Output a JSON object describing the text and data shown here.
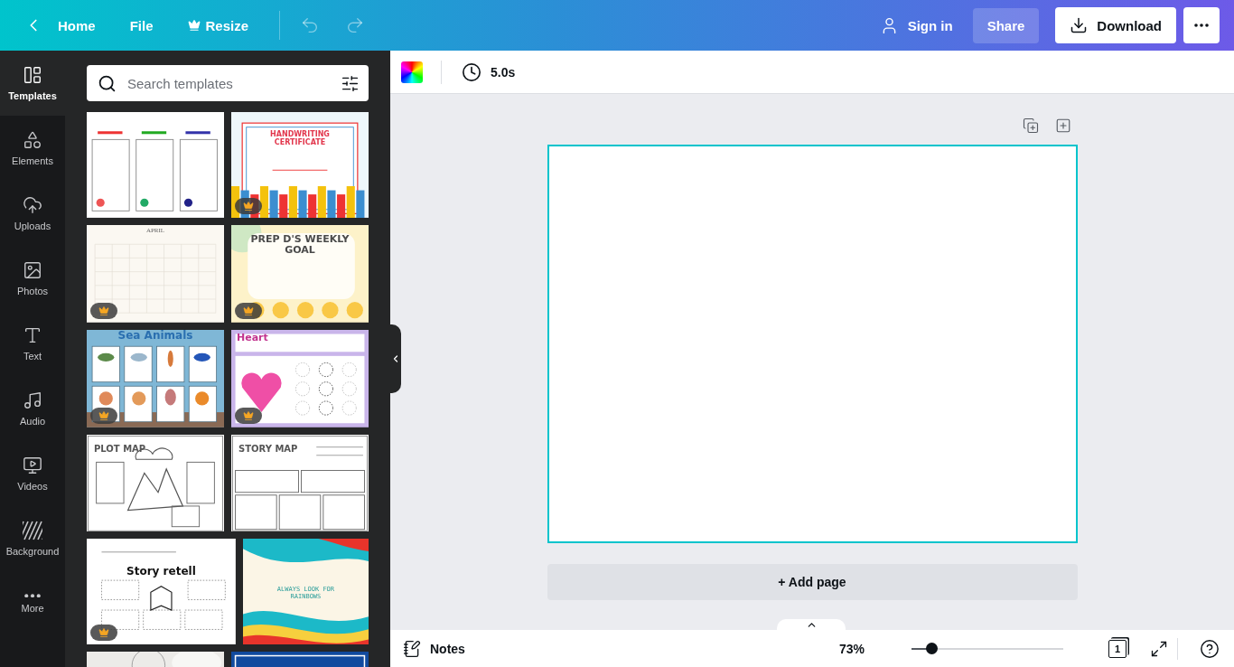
{
  "top_bar": {
    "back": "Home",
    "menu": [
      {
        "label": "File",
        "kind": "plain"
      },
      {
        "label": "Resize",
        "kind": "premium"
      }
    ],
    "sign_in": "Sign in",
    "share": "Share",
    "download": "Download"
  },
  "sidebar": {
    "items": [
      {
        "label": "Templates",
        "selected": true
      },
      {
        "label": "Elements",
        "selected": false
      },
      {
        "label": "Uploads",
        "selected": false
      },
      {
        "label": "Photos",
        "selected": false
      },
      {
        "label": "Text",
        "selected": false
      },
      {
        "label": "Audio",
        "selected": false
      },
      {
        "label": "Videos",
        "selected": false
      },
      {
        "label": "Background",
        "selected": false
      },
      {
        "label": "More",
        "selected": false
      }
    ]
  },
  "templates_panel": {
    "search": {
      "placeholder": "Search templates"
    },
    "rows": [
      [
        {
          "kind": "reading",
          "premium": false
        },
        {
          "kind": "certificate",
          "title": "HANDWRITING CERTIFICATE",
          "premium": true
        }
      ],
      [
        {
          "kind": "calendar",
          "title": "APRIL",
          "premium": true
        },
        {
          "kind": "goal",
          "title": "PREP D'S WEEKLY GOAL",
          "premium": true
        }
      ],
      [
        {
          "kind": "animals",
          "title": "Sea Animals",
          "premium": true
        },
        {
          "kind": "heart",
          "title": "Heart",
          "premium": true
        }
      ],
      [
        {
          "kind": "plotmap",
          "title": "PLOT MAP",
          "premium": false
        },
        {
          "kind": "storymap",
          "title": "STORY MAP",
          "premium": false
        }
      ],
      [
        {
          "kind": "retell",
          "title": "Story retell",
          "premium": true
        },
        {
          "kind": "rainbow",
          "title": "ALWAYS LOOK FOR RAINBOWS",
          "premium": false
        }
      ],
      [
        {
          "kind": "sketch"
        },
        {
          "kind": "blue"
        }
      ]
    ]
  },
  "canvas_toolbar": {
    "duration": "5.0s"
  },
  "canvas": {
    "add_page": "+ Add page"
  },
  "bottom_bar": {
    "notes": "Notes",
    "zoom": "73%",
    "zoom_slider": {
      "level": 0.13
    },
    "page_count": "1"
  }
}
